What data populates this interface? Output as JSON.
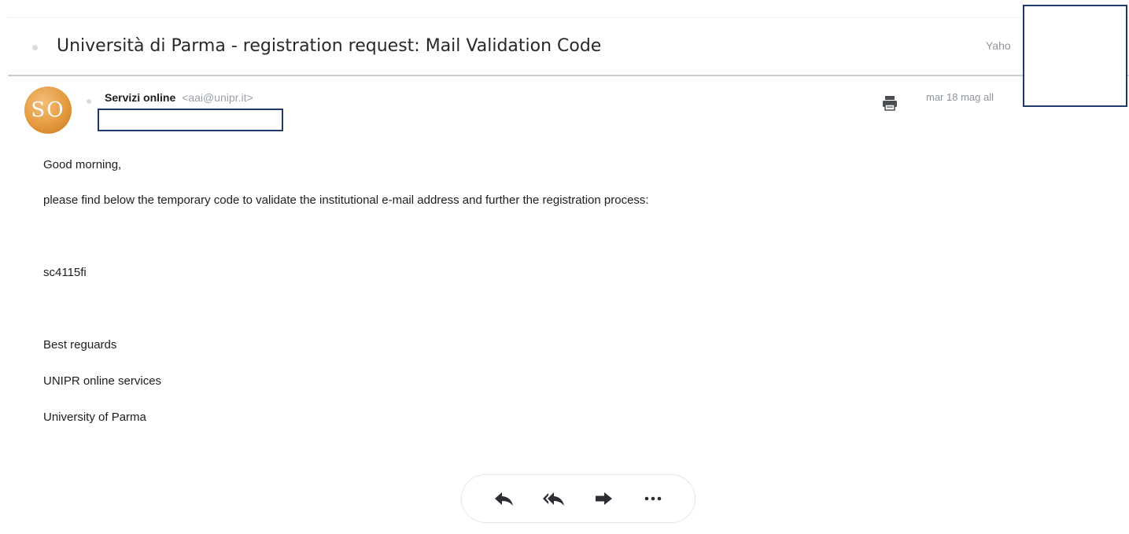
{
  "message": {
    "subject": "Università di Parma - registration request: Mail Validation Code",
    "folder": "Yaho",
    "sender": {
      "avatar_initials": "SO",
      "name": "Servizi online",
      "email": "<aai@unipr.it>"
    },
    "date": "mar 18 mag all",
    "body": {
      "greeting": "Good morning,",
      "intro": "please find below the temporary code to validate the institutional e-mail address and further the registration process:",
      "code": "sc4115fi",
      "closing": "Best reguards",
      "signature_line1": "UNIPR online services",
      "signature_line2": "University of Parma"
    }
  },
  "actions": {
    "icons": [
      "reply-icon",
      "reply-all-icon",
      "forward-icon",
      "more-icon"
    ]
  },
  "colors": {
    "redaction_border": "#1f3a6b",
    "avatar": "#e59a3f",
    "icon": "#2b2e33"
  }
}
